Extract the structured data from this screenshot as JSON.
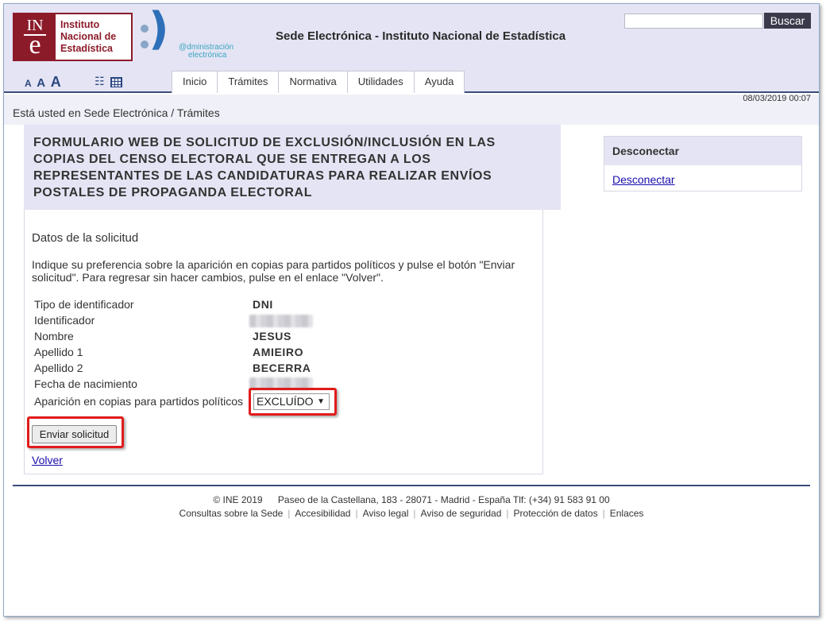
{
  "logo": {
    "ine_mark_top": "IN",
    "ine_mark_bottom": "e",
    "ine_line1": "Instituto",
    "ine_line2": "Nacional de",
    "ine_line3": "Estadística",
    "adm_line1": "@dministración",
    "adm_line2": "electrónica"
  },
  "header": {
    "site_title": "Sede Electrónica - Instituto Nacional de Estadística",
    "search_button": "Buscar",
    "date": "08/03/2019 00:07",
    "font_sizes": [
      "A",
      "A",
      "A"
    ]
  },
  "tabs": [
    "Inicio",
    "Trámites",
    "Normativa",
    "Utilidades",
    "Ayuda"
  ],
  "breadcrumb": {
    "prefix": "Está usted en",
    "items": [
      "Sede Electrónica",
      "Trámites"
    ],
    "separator": "/"
  },
  "form": {
    "title": "FORMULARIO WEB DE SOLICITUD DE EXCLUSIÓN/INCLUSIÓN EN LAS COPIAS DEL CENSO ELECTORAL QUE SE ENTREGAN A LOS REPRESENTANTES DE LAS CANDIDATURAS PARA REALIZAR ENVÍOS POSTALES DE PROPAGANDA ELECTORAL",
    "section_title": "Datos de la solicitud",
    "instructions": "Indique su preferencia sobre la aparición en copias para partidos políticos y pulse el botón \"Enviar solicitud\". Para regresar sin hacer cambios, pulse en el enlace \"Volver\".",
    "fields": [
      {
        "label": "Tipo de identificador",
        "value": "DNI"
      },
      {
        "label": "Identificador",
        "value": ""
      },
      {
        "label": "Nombre",
        "value": "JESUS"
      },
      {
        "label": "Apellido 1",
        "value": "AMIEIRO"
      },
      {
        "label": "Apellido 2",
        "value": "BECERRA"
      },
      {
        "label": "Fecha de nacimiento",
        "value": ""
      },
      {
        "label": "Aparición en copias para partidos políticos",
        "value": ""
      }
    ],
    "select_value": "EXCLUÍDO",
    "submit_label": "Enviar solicitud",
    "back_label": "Volver"
  },
  "sidebar": {
    "heading": "Desconectar",
    "link": "Desconectar"
  },
  "footer": {
    "copyright": "©  INE 2019",
    "address": "Paseo de la Castellana, 183 - 28071 - Madrid - España Tlf: (+34) 91 583 91 00",
    "links": [
      "Consultas sobre la Sede",
      "Accesibilidad",
      "Aviso legal",
      "Aviso de seguridad",
      "Protección de datos",
      "Enlaces"
    ]
  },
  "colors": {
    "header_bg": "#e4e4f4",
    "accent_navy": "#3d4c7a",
    "ine_red": "#8c1b2a",
    "highlight_red": "#e11b1b"
  }
}
